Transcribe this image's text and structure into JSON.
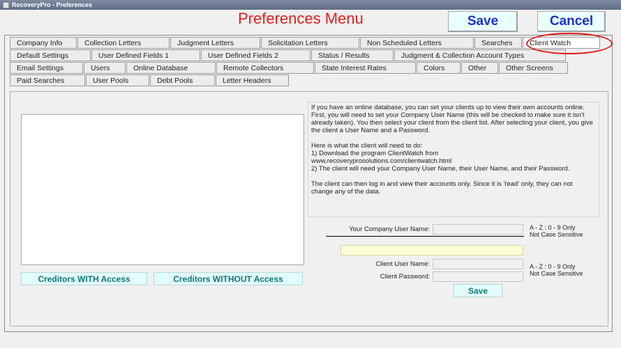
{
  "window": {
    "title": "RecoveryPro - Preferences"
  },
  "header": {
    "title": "Preferences Menu",
    "save_label": "Save",
    "cancel_label": "Cancel"
  },
  "tabs": {
    "row1": [
      "Company Info",
      "Collection Letters",
      "Judgment Letters",
      "Solicitation Letters",
      "Non Scheduled Letters",
      "Searches",
      "Client Watch"
    ],
    "row2": [
      "Default Settings",
      "User Defined Fields 1",
      "User Defined Fields 2",
      "Status / Results",
      "Judgment & Collection Account Types"
    ],
    "row3": [
      "Email Settings",
      "Users",
      "Online Database",
      "Remote Collectors",
      "State Interest Rates",
      "Colors",
      "Other",
      "Other Screens"
    ],
    "row4": [
      "Paid Searches",
      "User Pools",
      "Debt Pools",
      "Letter Headers"
    ],
    "active": "Client Watch"
  },
  "client_watch": {
    "creditors_with_label": "Creditors WITH Access",
    "creditors_without_label": "Creditors WITHOUT Access",
    "info": {
      "p1": "If you have an online database, you can set your clients up to view their own accounts online. First, you will need to set your Company User Name (this will be checked to make sure it isn't already taken). You then select your client from the client list. After selecting your client, you give the client a User Name and a Password.",
      "p2_line1": "Here is what the client will need to do:",
      "p2_line2": "1) Download the program ClientWatch from",
      "p2_line3": "www.recoveryprosolutions.com/clientwatch.html",
      "p2_line4": "2) The client will need your Company User Name, their User Name, and their Password.",
      "p3": "The client can then log in and view their accounts only. Since it is 'read' only, they can not change any of the data."
    },
    "company_user_name_label": "Your Company User Name:",
    "company_user_name_value": "",
    "company_hint_line1": "A - Z : 0 - 9 Only",
    "company_hint_line2": "Not Case Sensitive",
    "selected_client_value": "",
    "client_user_name_label": "Client User Name:",
    "client_user_name_value": "",
    "client_password_label": "Client Password:",
    "client_password_value": "",
    "client_hint_line1": "A - Z : 0 - 9 Only",
    "client_hint_line2": "Not Case Sensitive",
    "save_label": "Save"
  },
  "colors": {
    "title_red": "#e02020",
    "big_button_text": "#1a33c8",
    "cyan_button_text": "#0f7a7a",
    "highlight_circle": "#e01818"
  }
}
